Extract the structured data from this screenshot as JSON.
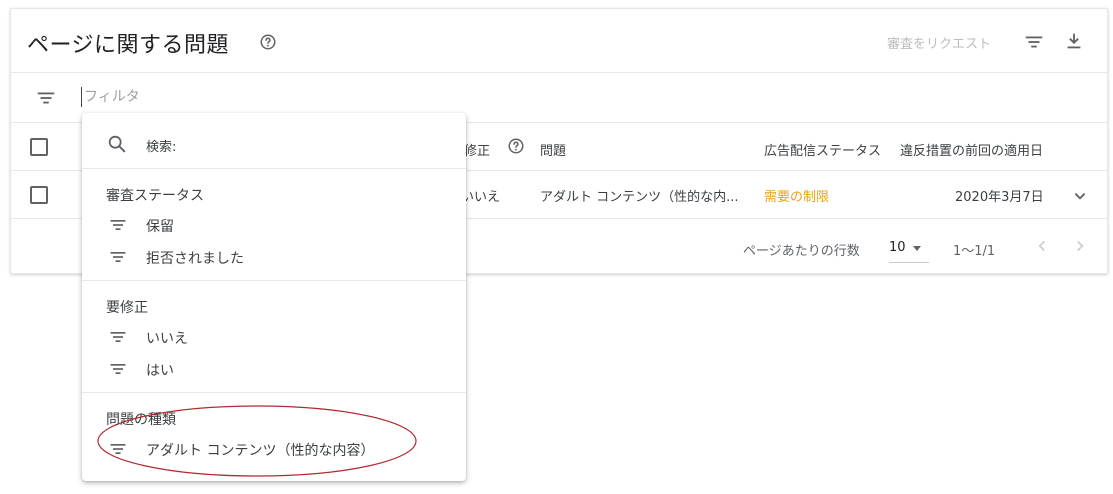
{
  "header": {
    "title": "ページに関する問題",
    "request_review_label": "審査をリクエスト"
  },
  "filter_bar": {
    "placeholder": "フィルタ"
  },
  "table": {
    "columns": {
      "fix_required": "要修正",
      "issue": "問題",
      "ad_serving_status": "広告配信ステータス",
      "last_enforced_date": "違反措置の前回の適用日"
    },
    "rows": [
      {
        "fix_required": "いいえ",
        "issue": "アダルト コンテンツ（性的な内...",
        "ad_serving_status": "需要の制限",
        "last_enforced_date": "2020年3月7日"
      }
    ]
  },
  "pagination": {
    "rows_per_page_label": "ページあたりの行数",
    "rows_per_page": "10",
    "range": "1〜1/1"
  },
  "dropdown": {
    "search_label": "検索:",
    "groups": [
      {
        "title": "審査ステータス",
        "items": [
          "保留",
          "拒否されました"
        ]
      },
      {
        "title": "要修正",
        "items": [
          "いいえ",
          "はい"
        ]
      },
      {
        "title": "問題の種類",
        "items": [
          "アダルト コンテンツ（性的な内容）"
        ]
      }
    ]
  },
  "colors": {
    "warning_status": "#e8a317",
    "annotation_ellipse": "#b02a30"
  }
}
